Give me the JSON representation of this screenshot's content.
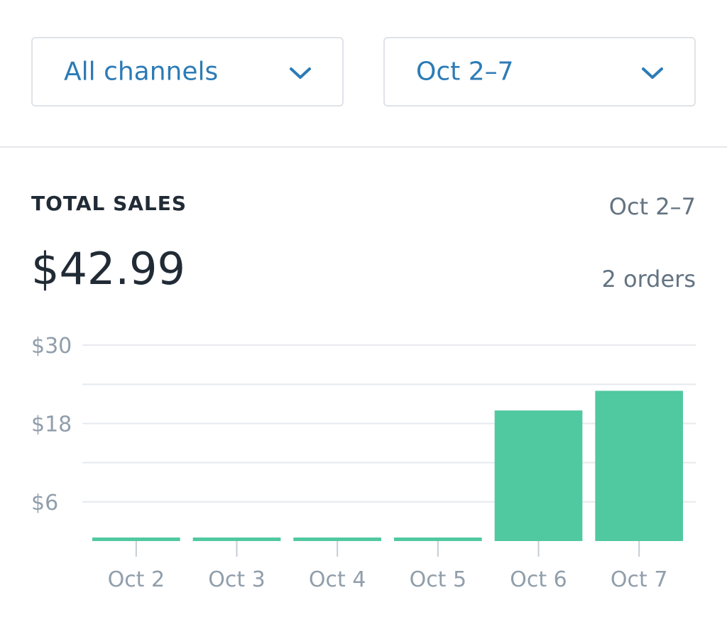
{
  "filters": {
    "channel": {
      "label": "All channels",
      "icon": "chevron-down-icon"
    },
    "date_range": {
      "label": "Oct 2–7",
      "icon": "chevron-down-icon"
    }
  },
  "summary": {
    "title": "TOTAL SALES",
    "range": "Oct 2–7",
    "total": "$42.99",
    "orders": "2 orders"
  },
  "colors": {
    "accent": "#2c7bb6",
    "bar": "#50c8a0",
    "grid": "#e6e9ed",
    "muted_text": "#919eab"
  },
  "chart_data": {
    "type": "bar",
    "categories": [
      "Oct 2",
      "Oct 3",
      "Oct 4",
      "Oct 5",
      "Oct 6",
      "Oct 7"
    ],
    "values": [
      0,
      0,
      0,
      0,
      19.99,
      23
    ],
    "yticks": [
      6,
      18,
      30
    ],
    "ytick_labels": [
      "$6",
      "$18",
      "$30"
    ],
    "ylim": [
      0,
      30
    ],
    "grid": true,
    "title": "",
    "xlabel": "",
    "ylabel": ""
  }
}
